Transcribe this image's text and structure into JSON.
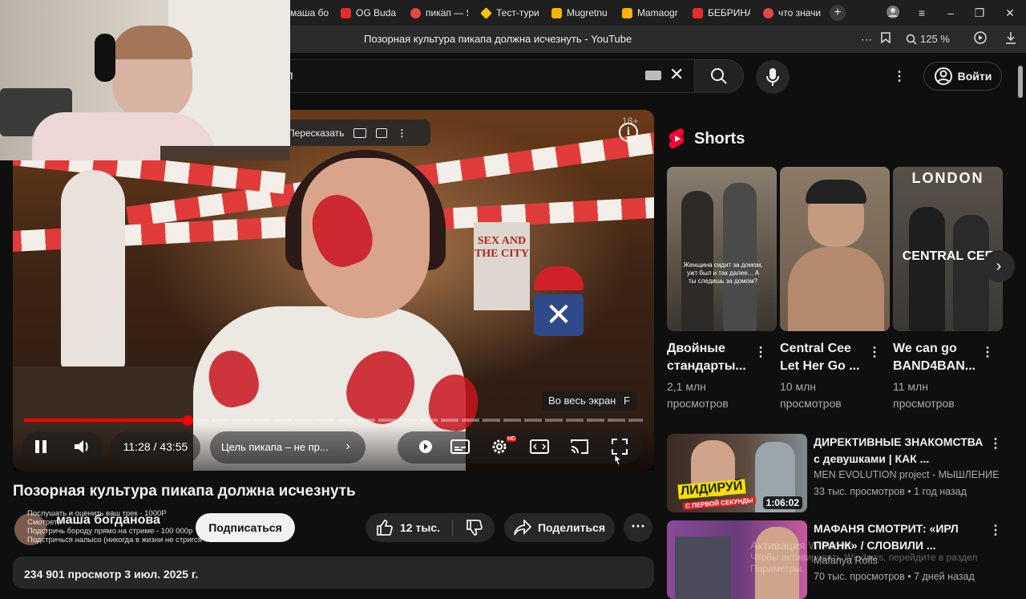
{
  "browser": {
    "tabs": [
      {
        "label": "маша бог",
        "favicon_color": "#e52d27"
      },
      {
        "label": "OG Buda",
        "favicon_color": "#e52d27"
      },
      {
        "label": "пикап — Я",
        "favicon_color": "#e64545"
      },
      {
        "label": "Тест-тури",
        "favicon_color": "#f5c400"
      },
      {
        "label": "Mugretnu",
        "favicon_color": "#f5b400"
      },
      {
        "label": "Mamaogr",
        "favicon_color": "#f5b400"
      },
      {
        "label": "БЕБРИНА",
        "favicon_color": "#e52d27"
      },
      {
        "label": "что значи",
        "favicon_color": "#e64545"
      }
    ],
    "new_tab_label": "+",
    "page_title": "Позорная культура пикапа должна исчезнуть - YouTube",
    "zoom": "125 %"
  },
  "header": {
    "search_value": "п",
    "signin_label": "Войти"
  },
  "player": {
    "age_badge": "18+",
    "summary_label": "Пересказать",
    "fullscreen_tooltip": "Во весь экран",
    "fullscreen_key": "F",
    "time": "11:28 / 43:55",
    "chapter": "Цель пикапа – не пр...",
    "progress_fraction": 0.26,
    "settings_badge": "HD",
    "book_text": "SEX AND THE CITY"
  },
  "video": {
    "title": "Позорная культура пикапа должна исчезнуть",
    "channel": "маша богданова",
    "channel_overlay": [
      "Послушать и оценить ваш трек - 1000Р",
      "Смотреть",
      "Подстричь бороду прямо на стриме - 100 000р",
      "Подстричься налысо (никогда в жизни не стригся"
    ],
    "subscribe_label": "Подписаться",
    "likes": "12 тыс.",
    "share_label": "Поделиться",
    "meta": "234 901 просмотр  3 июл. 2025 г."
  },
  "shorts": {
    "section_title": "Shorts",
    "items": [
      {
        "title": "Двойные стандарты...",
        "views": "2,1 млн просмотров",
        "thumb_text": "Женщина сидит за домом, ужт был и так далее... А ты следишь за домом?",
        "bg": "#5b5247"
      },
      {
        "title": "Central Cee Let Her Go ...",
        "views": "10 млн просмотров",
        "thumb_text": "",
        "bg": "#6e5a49"
      },
      {
        "title": "We can go BAND4BAN...",
        "views": "11 млн просмотров",
        "thumb_text": "LONDON",
        "thumb_text2": "CENTRAL CEE",
        "bg": "#3c3833"
      }
    ]
  },
  "recommended": [
    {
      "title": "ДИРЕКТИВНЫЕ ЗНАКОМСТВА с девушками | КАК ...",
      "channel": "MEN EVOLUTION project - МЫШЛЕНИЕ ...",
      "meta": "33 тыс. просмотров • 1 год назад",
      "duration": "1:06:02",
      "thumb_text": "ЛИДИРУЙ",
      "thumb_text2": "С ПЕРВОЙ СЕКУНДЫ"
    },
    {
      "title": "МАФАНЯ СМОТРИТ: «ИРЛ ПРАНК» / СЛОВИЛИ ...",
      "channel": "Mafanya Rofls",
      "meta": "70 тыс. просмотров • 7 дней назад",
      "duration": "",
      "thumb_text": "",
      "thumb_text2": ""
    }
  ],
  "activation_watermark": "Активация Windows",
  "activation_sub": "Чтобы активировать Windows, перейдите в раздел",
  "activation_sub2": "Параметры."
}
